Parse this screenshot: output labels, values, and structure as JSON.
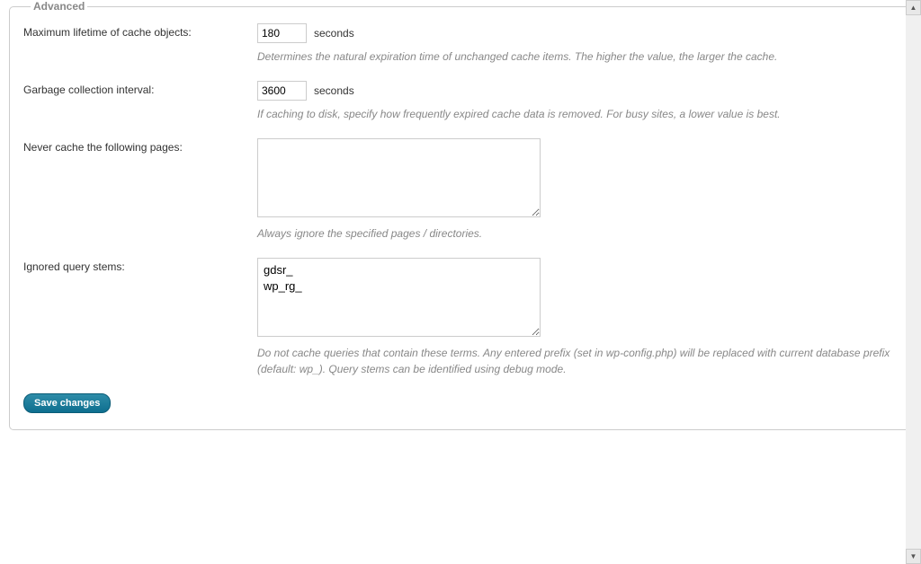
{
  "fieldset": {
    "legend": "Advanced"
  },
  "lifetime": {
    "label": "Maximum lifetime of cache objects:",
    "value": "180",
    "suffix": "seconds",
    "description": "Determines the natural expiration time of unchanged cache items. The higher the value, the larger the cache."
  },
  "gc": {
    "label": "Garbage collection interval:",
    "value": "3600",
    "suffix": "seconds",
    "description": "If caching to disk, specify how frequently expired cache data is removed. For busy sites, a lower value is best."
  },
  "never_cache": {
    "label": "Never cache the following pages:",
    "value": "",
    "description": "Always ignore the specified pages / directories."
  },
  "query_stems": {
    "label": "Ignored query stems:",
    "value": "gdsr_\nwp_rg_",
    "description": "Do not cache queries that contain these terms. Any entered prefix (set in wp-config.php) will be replaced with current database prefix (default: wp_). Query stems can be identified using debug mode."
  },
  "save": {
    "label": "Save changes"
  }
}
